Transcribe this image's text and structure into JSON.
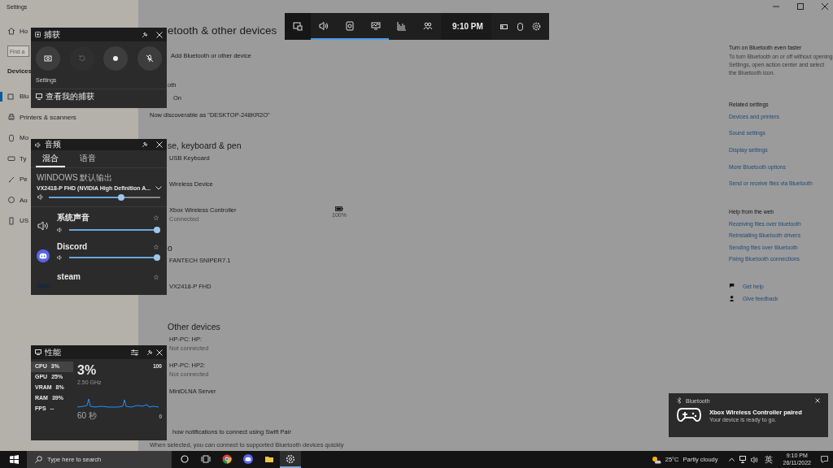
{
  "window": {
    "title": "Settings"
  },
  "sidebar": {
    "home": "Ho",
    "search": {
      "placeholder": "Find a"
    },
    "section": "Devices",
    "items": [
      {
        "label": "Blu",
        "kind": "bluetooth",
        "selected": true
      },
      {
        "label": "Printers & scanners",
        "kind": "printer",
        "selected": false
      },
      {
        "label": "Mo",
        "kind": "mouse",
        "selected": false
      },
      {
        "label": "Ty",
        "kind": "keyboard",
        "selected": false
      },
      {
        "label": "Pe",
        "kind": "pen",
        "selected": false
      },
      {
        "label": "Au",
        "kind": "autoplay",
        "selected": false
      },
      {
        "label": "US",
        "kind": "usb",
        "selected": false
      }
    ]
  },
  "main": {
    "title": "etooth & other devices",
    "add_device": "Add Bluetooth or other device",
    "bluetooth": {
      "label": "oth",
      "toggle_label": "On"
    },
    "discoverable": "Now discoverable as \"DESKTOP-248KR2O\"",
    "sections": [
      {
        "heading": "se, keyboard & pen",
        "devices": [
          {
            "name": "USB Keyboard"
          },
          {
            "name": "Wireless Device"
          },
          {
            "name": "Xbox Wireless Controller",
            "status": "Connected",
            "battery": "100%"
          }
        ]
      },
      {
        "heading": "o",
        "devices": [
          {
            "name": "FANTECH SNIPER7.1"
          },
          {
            "name": "VX2418-P FHD"
          }
        ]
      },
      {
        "heading": "Other devices",
        "devices": [
          {
            "name": "HP-PC: HP:",
            "status": "Not connected"
          },
          {
            "name": "HP-PC: HP2:",
            "status": "Not connected"
          },
          {
            "name": "MiniDLNA Server"
          }
        ]
      }
    ],
    "swift_pair": {
      "label": "how notifications to connect using Swift Pair",
      "description": "When selected, you can connect to supported Bluetooth devices quickly"
    }
  },
  "right_panel": {
    "tip": {
      "heading": "Turn on Bluetooth even faster",
      "text": "To turn Bluetooth on or off without opening Settings, open action center and select the Bluetooth icon."
    },
    "related": {
      "heading": "Related settings",
      "links": [
        "Devices and printers",
        "Sound settings",
        "Display settings",
        "More Bluetooth options",
        "Send or receive files via Bluetooth"
      ]
    },
    "help": {
      "heading": "Help from the web",
      "links": [
        "Receiving files over bluetooth",
        "Reinstalling Bluetooth drivers",
        "Sending files over Bluetooth",
        "Fixing Bluetooth connections"
      ]
    },
    "support": [
      {
        "kind": "help",
        "label": "Get help"
      },
      {
        "kind": "feedback",
        "label": "Give feedback"
      }
    ]
  },
  "game_bar": {
    "buttons": [
      {
        "kind": "widgets",
        "selected": false
      },
      {
        "kind": "audio",
        "selected": true
      },
      {
        "kind": "capture",
        "selected": true
      },
      {
        "kind": "performance",
        "selected": true
      },
      {
        "kind": "resources",
        "selected": false
      },
      {
        "kind": "social",
        "selected": false
      }
    ],
    "time": "9:10 PM"
  },
  "capture_widget": {
    "title": "捕获",
    "buttons": [
      {
        "kind": "screenshot",
        "disabled": false
      },
      {
        "kind": "replay",
        "disabled": true
      },
      {
        "kind": "record",
        "disabled": false
      },
      {
        "kind": "mic-off",
        "disabled": false
      }
    ],
    "settings_label": "Settings",
    "gallery_link": "查看我的捕获"
  },
  "audio_widget": {
    "title": "音频",
    "tabs": [
      {
        "label": "混合",
        "selected": true
      },
      {
        "label": "语音",
        "selected": false
      }
    ],
    "output_label": "WINDOWS 默认输出",
    "device": "VX2418-P FHD (NVIDIA High Definition A...",
    "master": {
      "level": 0.65
    },
    "apps": [
      {
        "name": "系统声音",
        "kind": "system",
        "level": 1
      },
      {
        "name": "Discord",
        "kind": "discord",
        "level": 1
      },
      {
        "name": "steam",
        "kind": "steam"
      }
    ]
  },
  "performance_widget": {
    "title": "性能",
    "stats": [
      {
        "label": "CPU",
        "value": "3%",
        "selected": true
      },
      {
        "label": "GPU",
        "value": "25%",
        "selected": false
      },
      {
        "label": "VRAM",
        "value": "8%",
        "selected": false
      },
      {
        "label": "RAM",
        "value": "39%",
        "selected": false
      },
      {
        "label": "FPS",
        "value": "--",
        "selected": false
      }
    ],
    "big_value": "3%",
    "frequency": "2.50 GHz",
    "axis_max": "100",
    "axis_min": "0",
    "time_span": "60 秒"
  },
  "notification": {
    "app": "Bluetooth",
    "title": "Xbox Wireless Controller paired",
    "body": "Your device is ready to go."
  },
  "taskbar": {
    "search_placeholder": "Type here to search",
    "apps": [
      {
        "kind": "cortana",
        "active": false
      },
      {
        "kind": "task-view",
        "active": false
      },
      {
        "kind": "chrome",
        "active": false
      },
      {
        "kind": "discord",
        "active": false
      },
      {
        "kind": "explorer",
        "active": false
      },
      {
        "kind": "settings",
        "active": true
      }
    ],
    "temperature": "25°C",
    "weather": "Partly cloudy",
    "input_method": "英",
    "time": "9:10 PM",
    "date": "26/11/2022"
  }
}
